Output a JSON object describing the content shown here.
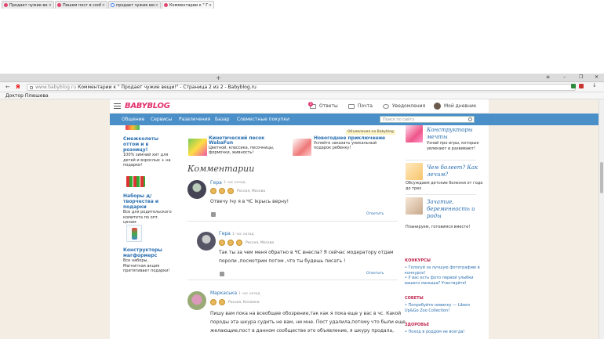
{
  "browser": {
    "tabs": [
      {
        "label": "Продает чужие вещ"
      },
      {
        "label": "Пишем пост в сооб"
      },
      {
        "label": "продает чужие вещи"
      },
      {
        "label": "Комментарии к \" Про"
      }
    ],
    "new_tab": "+",
    "url_domain": "www.babyblog.ru",
    "url_title": "Комментарии к \" Продает чужие вещи!\" - Страница 2 из 2 - Babyblog.ru",
    "bookmark": "Доктор Плюшева"
  },
  "site": {
    "logo": "BABYBLOG",
    "header": {
      "answers": "Ответы",
      "answers_badge": "3",
      "mail": "Почта",
      "notifications": "Уведомления",
      "my_diary": "Мой дневник"
    },
    "nav": [
      "Общение",
      "Сервисы",
      "Развлечения",
      "Базар",
      "Совместные покупки"
    ],
    "search_placeholder": "Поиск по сайту"
  },
  "left_col": [
    {
      "title": "Смежколеты оттом и в розницу!",
      "desc": "100% зимний хит для детей и взрослых + на подарки!"
    },
    {
      "title": "Наборы д/творчества и подарки",
      "desc": "Все для родительского комитета по опт. ценам"
    },
    {
      "title": "Конструкторы магформерс",
      "desc": "Все наборы. Магнитная акция притягивает подарки!"
    }
  ],
  "promos": [
    {
      "title": "Кинетический песок WabaFun",
      "desc": "Цветной, классика, песочницы, формочки, живность!"
    },
    {
      "title": "Новогоднее приключение",
      "desc": "Успейте заказать уникальный подарок ребенку!",
      "tag": "Объявления на Babyblog"
    }
  ],
  "comments_heading": "Комментарии",
  "comments": [
    {
      "name": "Гера",
      "time": "1 час назад",
      "location": "Россия, Москва",
      "text": "Отвечу Ічу я в ЧС Ікрысь верну!",
      "reply": "Ответить"
    },
    {
      "name": "Гера",
      "time": "1 час назад",
      "location": "Россия, Москва",
      "text1": "Так ты за чем меня обратно в ЧС внесла? Я сейчас модератору отдам",
      "text2": "пороли ,посмотрим потом ,что ты будешь писать !",
      "reply": "Ответить"
    },
    {
      "name": "Маркаська",
      "time": "1 час назад",
      "location": "Россия, Коломна",
      "lines": [
        "Пишу вам пока на всеобщее обозрение,так как я пока еще у вас в чс. Какой",
        "породы эта шкура судить не вам, ни мне. Пост удалила,потому что были еще",
        "желающие,пост в данном сообществе это объявление, я шкуру продала,"
      ]
    }
  ],
  "right_col": [
    {
      "title": "Конструкторы мечты",
      "desc": "Узнай про игры, которые увлекают и развивают!"
    },
    {
      "title": "Чем болеет? Как лечим?",
      "desc": "Обсуждаем детские болезни от года до трех"
    },
    {
      "title": "Зачатие, беременность и роды",
      "desc": "Планируем, готовимся вместе!"
    }
  ],
  "sections": [
    {
      "heading": "КОНКУРСЫ",
      "items": [
        "Голосуй за лучшую фотографию в конкурсе!",
        "У вас есть фото первой улыбки вашего малыша? Участвуйте!"
      ]
    },
    {
      "heading": "СОВЕТЫ",
      "items": [
        "Попробуйте новинку — Libero Up&Go Zoo Collection!"
      ]
    },
    {
      "heading": "ЗДОРОВЬЕ",
      "items": [
        "Поход в роддом не всегда!"
      ]
    }
  ],
  "colors": {
    "brand": "#e3336f",
    "nav": "#4a8fc8",
    "link": "#2a6fb0",
    "page_bg": "#f3ede3"
  }
}
